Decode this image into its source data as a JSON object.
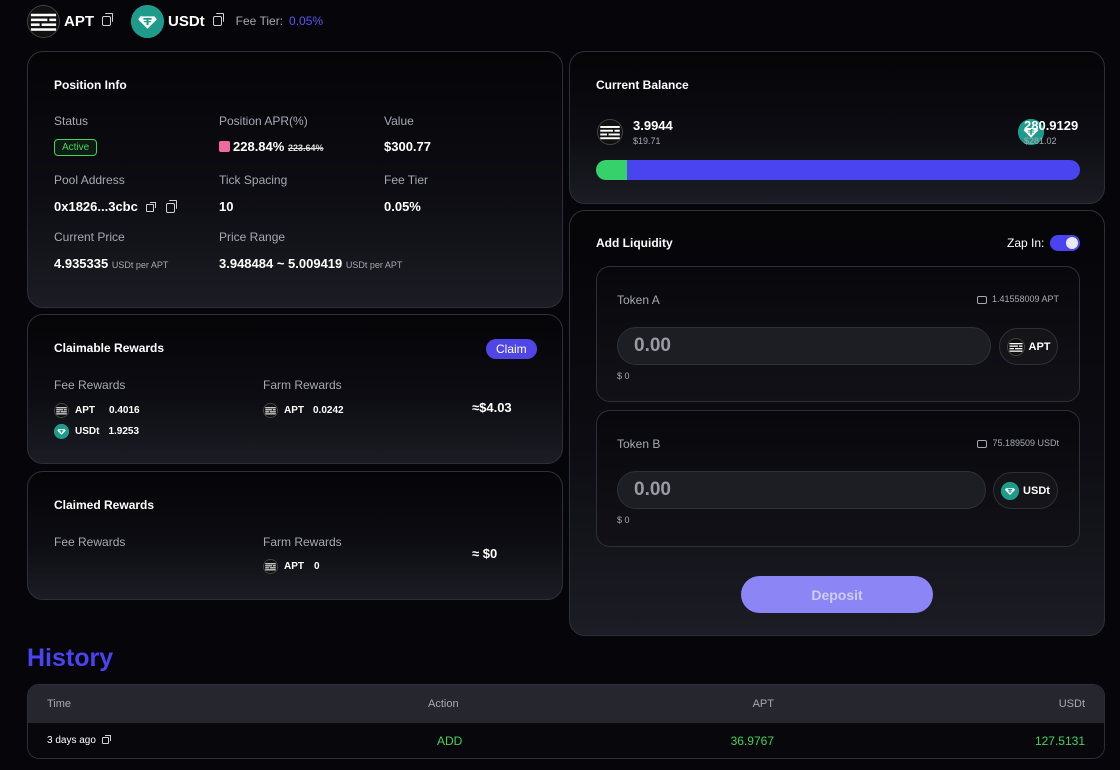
{
  "header": {
    "token_a": "APT",
    "token_b": "USDt",
    "fee_tier_label": "Fee Tier:",
    "fee_tier_value": "0.05%"
  },
  "position_info": {
    "title": "Position Info",
    "status_label": "Status",
    "status_value": "Active",
    "apr_label": "Position APR(%)",
    "apr_value": "228.84%",
    "apr_old": "223.64%",
    "value_label": "Value",
    "value_value": "$300.77",
    "pool_address_label": "Pool Address",
    "pool_address_value": "0x1826...3cbc",
    "tick_spacing_label": "Tick Spacing",
    "tick_spacing_value": "10",
    "fee_tier_label": "Fee Tier",
    "fee_tier_value": "0.05%",
    "current_price_label": "Current Price",
    "current_price_value": "4.935335",
    "current_price_unit": "USDt per APT",
    "price_range_label": "Price Range",
    "price_range_value": "3.948484 ~ 5.009419",
    "price_range_unit": "USDt per APT"
  },
  "claimable": {
    "title": "Claimable Rewards",
    "claim_label": "Claim",
    "fee_rewards_label": "Fee Rewards",
    "farm_rewards_label": "Farm Rewards",
    "fee_apt_symbol": "APT",
    "fee_apt_amount": "0.4016",
    "fee_usdt_symbol": "USDt",
    "fee_usdt_amount": "1.9253",
    "farm_apt_symbol": "APT",
    "farm_apt_amount": "0.0242",
    "total": "≈$4.03"
  },
  "claimed": {
    "title": "Claimed Rewards",
    "fee_rewards_label": "Fee Rewards",
    "farm_rewards_label": "Farm Rewards",
    "farm_apt_symbol": "APT",
    "farm_apt_amount": "0",
    "total": "≈ $0"
  },
  "balance": {
    "title": "Current Balance",
    "apt_amount": "3.9944",
    "apt_usd": "$19.71",
    "usdt_amount": "280.9129",
    "usdt_usd": "$281.02",
    "apt_share": 0.065,
    "colors": {
      "apt": "#36d16a",
      "usdt": "#4a44f0"
    }
  },
  "add_liquidity": {
    "title": "Add Liquidity",
    "zap_label": "Zap In:",
    "token_a_label": "Token A",
    "token_a_balance": "1.41558009 APT",
    "token_a_value": "0.00",
    "token_a_symbol": "APT",
    "token_a_usd": "$ 0",
    "token_b_label": "Token B",
    "token_b_balance": "75.189509 USDt",
    "token_b_value": "0.00",
    "token_b_symbol": "USDt",
    "token_b_usd": "$ 0",
    "deposit_label": "Deposit"
  },
  "history": {
    "title": "History",
    "columns": [
      "Time",
      "Action",
      "APT",
      "USDt"
    ],
    "rows": [
      {
        "time": "3 days ago",
        "action": "ADD",
        "apt": "36.9767",
        "usdt": "127.5131"
      }
    ]
  },
  "colors": {
    "accent": "#4a44f0",
    "green": "#3fd35a",
    "teal": "#1e9b8a"
  }
}
